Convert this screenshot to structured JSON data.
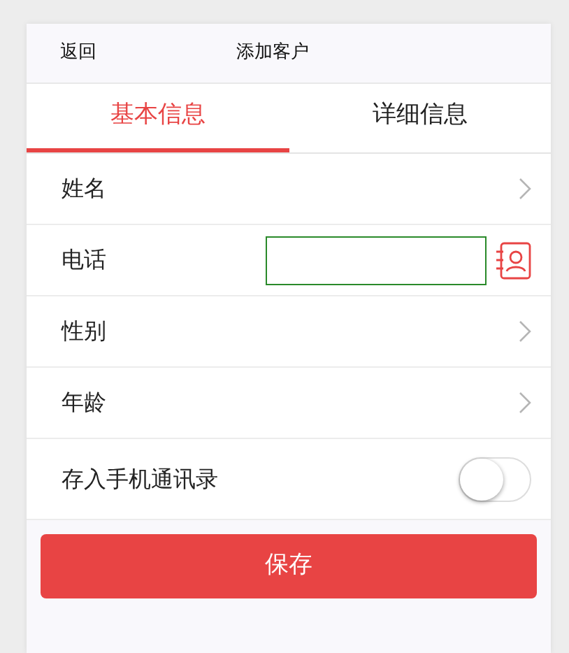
{
  "header": {
    "back_label": "返回",
    "title": "添加客户"
  },
  "tabs": [
    {
      "label": "基本信息",
      "selected": true
    },
    {
      "label": "详细信息",
      "selected": false
    }
  ],
  "rows": [
    {
      "kind": "arrow",
      "label": "姓名"
    },
    {
      "kind": "phone",
      "label": "电话"
    },
    {
      "kind": "arrow",
      "label": "性别"
    },
    {
      "kind": "arrow",
      "label": "年龄"
    },
    {
      "kind": "toggle",
      "label": "存入手机通讯录",
      "on": false
    }
  ],
  "save_button": "保存"
}
